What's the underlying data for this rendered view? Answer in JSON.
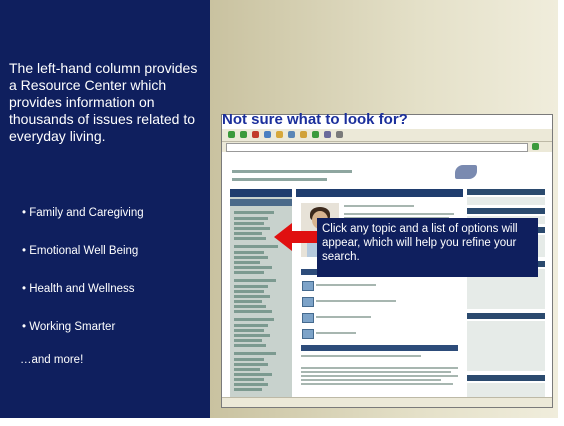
{
  "left_panel": {
    "intro": "The left-hand column provides a Resource Center which provides information on thousands of issues related to everyday living.",
    "bullets": [
      "• Family and Caregiving",
      "• Emotional Well Being",
      "• Health and Wellness",
      "• Working Smarter"
    ],
    "more": "…and more!"
  },
  "headline": "Not sure what to look for?",
  "callout": "Click any topic and a list of options will appear, which will help you refine your search.",
  "colors": {
    "left_bg": "#0f1f5e",
    "headline": "#1b2f9c",
    "arrow": "#e01010",
    "callout_bg": "#0f1f5e"
  }
}
